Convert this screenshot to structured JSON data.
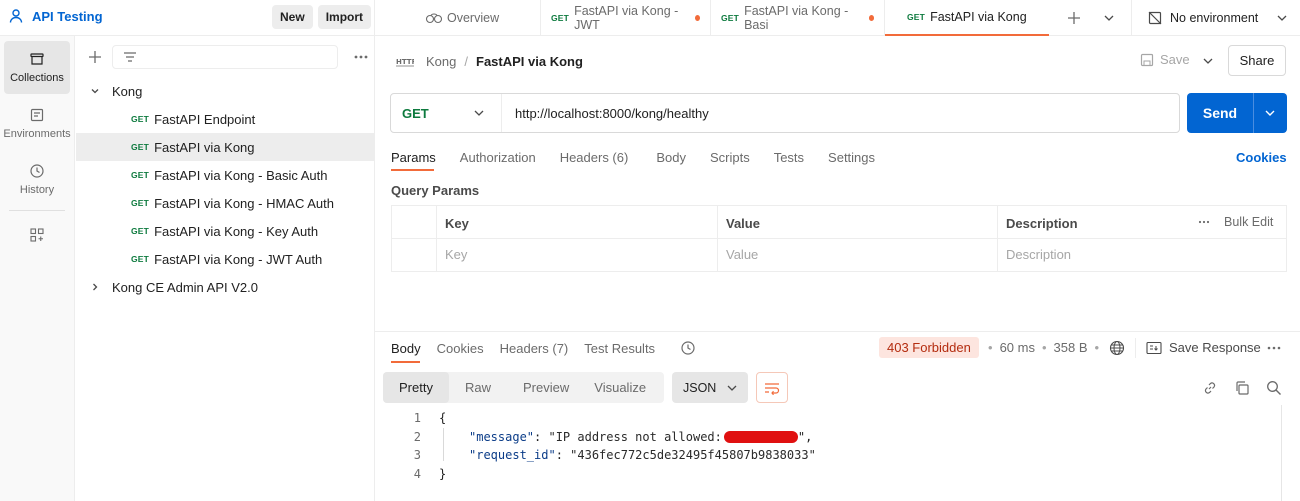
{
  "workspace": {
    "title": "API Testing",
    "new_label": "New",
    "import_label": "Import"
  },
  "rail": [
    {
      "label": "Collections",
      "icon": "collections-icon"
    },
    {
      "label": "Environments",
      "icon": "environments-icon"
    },
    {
      "label": "History",
      "icon": "history-icon"
    },
    {
      "label": "",
      "icon": "apps-icon"
    }
  ],
  "sidebar": {
    "collections": [
      {
        "name": "Kong",
        "expanded": true,
        "items": [
          {
            "method": "GET",
            "name": "FastAPI Endpoint"
          },
          {
            "method": "GET",
            "name": "FastAPI via Kong",
            "selected": true
          },
          {
            "method": "GET",
            "name": "FastAPI via Kong - Basic Auth"
          },
          {
            "method": "GET",
            "name": "FastAPI via Kong - HMAC Auth"
          },
          {
            "method": "GET",
            "name": "FastAPI via Kong - Key Auth"
          },
          {
            "method": "GET",
            "name": "FastAPI via Kong - JWT Auth"
          }
        ]
      },
      {
        "name": "Kong CE Admin API V2.0",
        "expanded": false
      }
    ]
  },
  "tabs": [
    {
      "label": "Overview"
    },
    {
      "method": "GET",
      "label": "FastAPI via Kong - JWT",
      "unsaved": true
    },
    {
      "method": "GET",
      "label": "FastAPI via Kong - Basi",
      "unsaved": true
    },
    {
      "method": "GET",
      "label": "FastAPI via Kong",
      "active": true
    }
  ],
  "environment": "No environment",
  "breadcrumb": {
    "parent": "Kong",
    "current": "FastAPI via Kong"
  },
  "actions": {
    "save": "Save",
    "share": "Share"
  },
  "request": {
    "method": "GET",
    "url": "http://localhost:8000/kong/healthy",
    "send": "Send"
  },
  "request_tabs": [
    "Params",
    "Authorization",
    "Headers (6)",
    "Body",
    "Scripts",
    "Tests",
    "Settings"
  ],
  "cookies_link": "Cookies",
  "query_params": {
    "title": "Query Params",
    "headers": [
      "Key",
      "Value",
      "Description"
    ],
    "bulk_edit": "Bulk Edit",
    "placeholders": [
      "Key",
      "Value",
      "Description"
    ]
  },
  "response": {
    "tabs": [
      "Body",
      "Cookies",
      "Headers (7)",
      "Test Results"
    ],
    "status": "403 Forbidden",
    "time": "60 ms",
    "size": "358 B",
    "save_response": "Save Response",
    "views": [
      "Pretty",
      "Raw",
      "Preview",
      "Visualize"
    ],
    "format": "JSON",
    "lines": [
      "1",
      "2",
      "3",
      "4"
    ],
    "body": {
      "open": "{",
      "k1": "\"message\"",
      "v1": "\"IP address not allowed:",
      "v1_end": "\",",
      "k2": "\"request_id\"",
      "v2": "\"436fec772c5de32495f45807b9838033\"",
      "close": "}"
    }
  },
  "colors": {
    "accent": "#f26b3a",
    "send": "#0265d2",
    "status_bg": "#fde5df",
    "status_text": "#b42c0f",
    "get": "#0d7a3e",
    "redaction": "#e01010"
  }
}
